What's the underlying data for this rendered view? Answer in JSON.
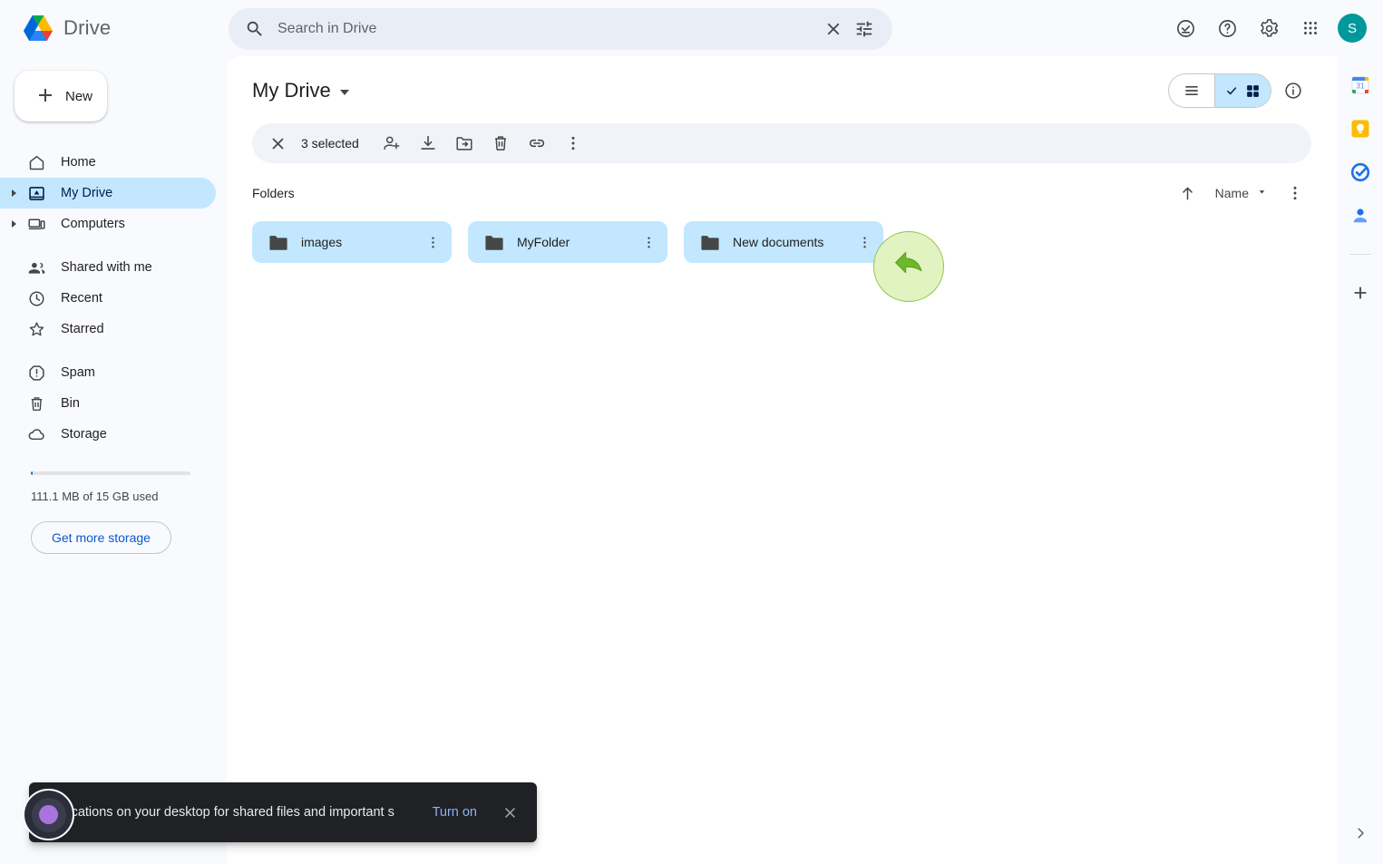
{
  "app": {
    "brand_name": "Drive",
    "avatar_initial": "S"
  },
  "search": {
    "placeholder": "Search in Drive",
    "value": "",
    "clear_label": "Clear search",
    "options_label": "Search options"
  },
  "topbar_icons": [
    {
      "name": "activity-icon",
      "label": "Activity"
    },
    {
      "name": "help-icon",
      "label": "Support"
    },
    {
      "name": "gear-icon",
      "label": "Settings"
    },
    {
      "name": "apps-grid-icon",
      "label": "Google apps"
    }
  ],
  "sidebar": {
    "new_button": "New",
    "items": [
      {
        "label": "Home",
        "icon": "home-icon",
        "active": false,
        "expandable": false
      },
      {
        "label": "My Drive",
        "icon": "my-drive-icon",
        "active": true,
        "expandable": true
      },
      {
        "label": "Computers",
        "icon": "computers-icon",
        "active": false,
        "expandable": true
      },
      {
        "label": "Shared with me",
        "icon": "people-icon",
        "active": false,
        "expandable": false
      },
      {
        "label": "Recent",
        "icon": "clock-icon",
        "active": false,
        "expandable": false
      },
      {
        "label": "Starred",
        "icon": "star-icon",
        "active": false,
        "expandable": false
      },
      {
        "label": "Spam",
        "icon": "spam-icon",
        "active": false,
        "expandable": false
      },
      {
        "label": "Bin",
        "icon": "trash-icon",
        "active": false,
        "expandable": false
      },
      {
        "label": "Storage",
        "icon": "cloud-icon",
        "active": false,
        "expandable": false
      }
    ],
    "storage_text": "111.1 MB of 15 GB used",
    "storage_percent": 1,
    "storage_button": "Get more storage"
  },
  "main": {
    "page_title": "My Drive",
    "selection": {
      "close_label": "Clear selection",
      "count_text": "3 selected",
      "actions": [
        {
          "name": "share-button",
          "label": "Share"
        },
        {
          "name": "download-button",
          "label": "Download"
        },
        {
          "name": "move-to-folder-button",
          "label": "Move to"
        },
        {
          "name": "delete-button",
          "label": "Move to bin"
        },
        {
          "name": "get-link-button",
          "label": "Get link"
        },
        {
          "name": "more-actions-button",
          "label": "More actions"
        }
      ]
    },
    "view_toggle": {
      "list_label": "List view",
      "grid_label": "Grid view",
      "active": "grid"
    },
    "details_label": "View details",
    "section_title": "Folders",
    "sort": {
      "direction_label": "Sort ascending",
      "field": "Name",
      "more_label": "More sort options"
    },
    "folders": [
      {
        "name": "images",
        "selected": true
      },
      {
        "name": "MyFolder",
        "selected": true
      },
      {
        "name": "New documents",
        "selected": true
      }
    ]
  },
  "rail": {
    "items": [
      {
        "name": "google-calendar-icon",
        "label": "Calendar"
      },
      {
        "name": "google-keep-icon",
        "label": "Keep"
      },
      {
        "name": "google-tasks-icon",
        "label": "Tasks"
      },
      {
        "name": "google-contacts-icon",
        "label": "Contacts"
      }
    ],
    "add_label": "Get add-ons",
    "expand_label": "Show side panel"
  },
  "snackbar": {
    "message": "otifications on your desktop for shared files and important s",
    "action": "Turn on",
    "close_label": "Dismiss"
  },
  "colors": {
    "selection_blue": "#c2e7ff",
    "accent_blue": "#0b57d0",
    "avatar_teal": "#00999b",
    "cursor_green": "#8ec63f"
  }
}
